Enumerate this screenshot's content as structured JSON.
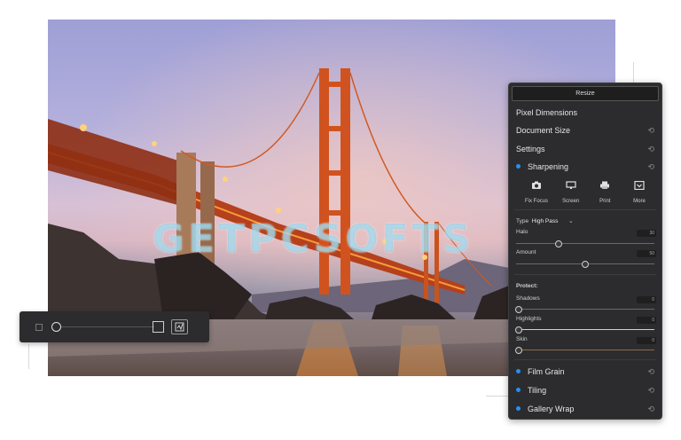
{
  "watermark": "GETPCSOFTS",
  "panel": {
    "header": "Resize",
    "pixel_dimensions": "Pixel Dimensions",
    "document_size": "Document Size",
    "settings": "Settings",
    "sharpening": "Sharpening",
    "tools": [
      {
        "label": "Fix Focus",
        "icon": "camera-icon"
      },
      {
        "label": "Screen",
        "icon": "monitor-icon"
      },
      {
        "label": "Print",
        "icon": "printer-icon"
      },
      {
        "label": "More",
        "icon": "more-icon"
      }
    ],
    "type_label": "Type",
    "type_value": "High Pass",
    "halo_label": "Halo",
    "halo_value": "30",
    "amount_label": "Amount",
    "amount_value": "50",
    "protect_label": "Protect:",
    "shadows_label": "Shadows",
    "shadows_value": "0",
    "highlights_label": "Highlights",
    "highlights_value": "0",
    "skin_label": "Skin",
    "skin_value": "0",
    "film_grain": "Film Grain",
    "tiling": "Tiling",
    "gallery_wrap": "Gallery Wrap",
    "accent_color": "#2b8ef0",
    "undo_icon": "undo-icon"
  },
  "zoom": {
    "level": 0.0
  }
}
